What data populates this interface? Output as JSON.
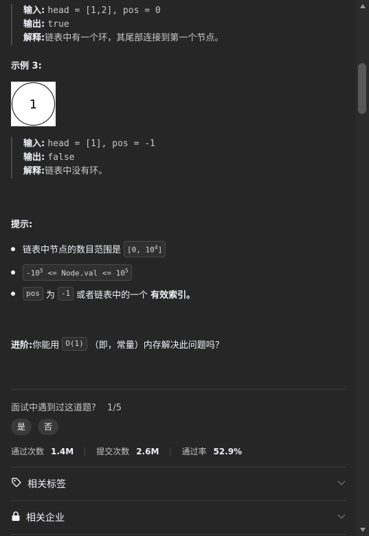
{
  "example2": {
    "input_label": "输入:",
    "input_value": "head = [1,2], pos = 0",
    "output_label": "输出:",
    "output_value": "true",
    "explain_label": "解释:",
    "explain_text": "链表中有一个环，其尾部连接到第一个节点。"
  },
  "example3": {
    "heading": "示例 3:",
    "node_value": "1",
    "input_label": "输入:",
    "input_value": "head = [1], pos = -1",
    "output_label": "输出:",
    "output_value": "false",
    "explain_label": "解释:",
    "explain_text": "链表中没有环。"
  },
  "hints": {
    "heading": "提示:",
    "items": [
      {
        "text": "链表中节点的数目范围是",
        "code": "[0, 10",
        "code_sup": "4",
        "code_end": "]"
      },
      {
        "code_a": "-10",
        "code_a_sup": "5",
        "code_b": " <= Node.val <= 10",
        "code_b_sup": "5"
      },
      {
        "code1": "pos",
        "mid1": "为",
        "code2": "-1",
        "text": "或者链表中的一个",
        "bold": "有效索引",
        "end": "。"
      }
    ]
  },
  "advanced": {
    "label": "进阶:",
    "text_before": "你能用",
    "code": "O(1)",
    "text_after": "（即，常量）内存解决此问题吗？"
  },
  "interview": {
    "question": "面试中遇到过这道题?",
    "count": "1/5",
    "yes": "是",
    "no": "否"
  },
  "stats": {
    "accepted_label": "通过次数",
    "accepted_value": "1.4M",
    "submissions_label": "提交次数",
    "submissions_value": "2.6M",
    "rate_label": "通过率",
    "rate_value": "52.9%"
  },
  "accordions": [
    {
      "label": "相关标签",
      "icon": "tag-icon"
    },
    {
      "label": "相关企业",
      "icon": "lock-icon"
    }
  ]
}
